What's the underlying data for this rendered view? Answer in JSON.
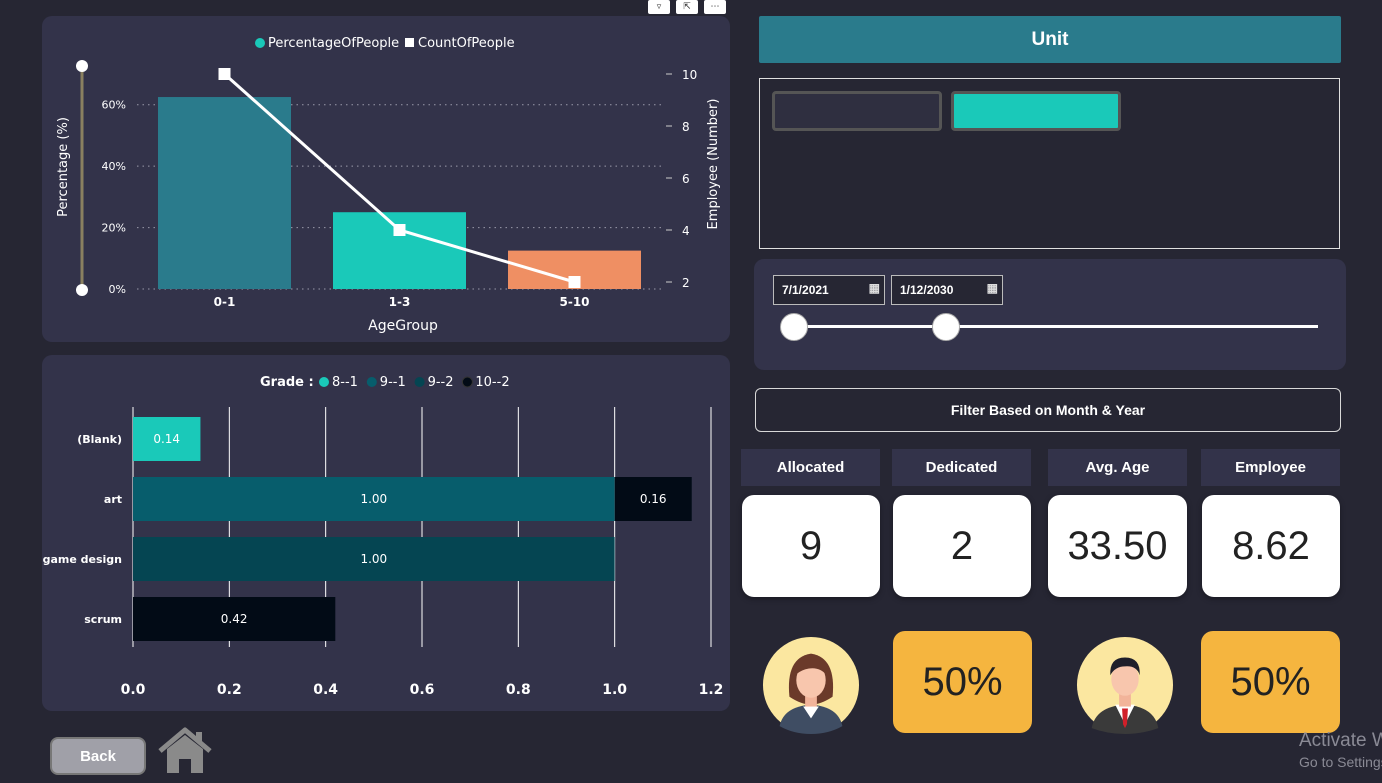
{
  "chart_data": [
    {
      "type": "bar",
      "legend": [
        "PercentageOfPeople",
        "CountOfPeople"
      ],
      "legend_position": "top",
      "xlabel": "AgeGroup",
      "ylabel": "Percentage (%)",
      "y2label": "Employee (Number)",
      "categories": [
        "0-1",
        "1-3",
        "5-10"
      ],
      "series": [
        {
          "name": "PercentageOfPeople",
          "kind": "bar",
          "values": [
            62.5,
            25,
            12.5
          ]
        },
        {
          "name": "CountOfPeople",
          "kind": "line",
          "values": [
            10,
            4,
            2
          ]
        }
      ],
      "ylim": [
        0,
        70
      ],
      "y2lim": [
        2,
        10
      ],
      "yticks": [
        "0%",
        "20%",
        "40%",
        "60%"
      ],
      "y2ticks": [
        "2",
        "4",
        "6",
        "8",
        "10"
      ],
      "bar_colors": [
        "#2a7b8c",
        "#1ac9b9",
        "#ef8f63"
      ],
      "grid": true
    },
    {
      "type": "bar",
      "orientation": "horizontal",
      "stacked": true,
      "legend_title": "Grade :",
      "legend_position": "top",
      "categories": [
        "(Blank)",
        "art",
        "game design",
        "scrum"
      ],
      "series": [
        {
          "name": "8--1",
          "color": "#1ac9b9",
          "values": [
            0.14,
            0,
            0,
            0
          ]
        },
        {
          "name": "9--1",
          "color": "#075d6c",
          "values": [
            0,
            1.0,
            0,
            0
          ]
        },
        {
          "name": "9--2",
          "color": "#054552",
          "values": [
            0,
            0,
            1.0,
            0
          ]
        },
        {
          "name": "10--2",
          "color": "#020b16",
          "values": [
            0,
            0.16,
            0,
            0.42
          ]
        }
      ],
      "xlim": [
        0,
        1.2
      ],
      "xticks": [
        "0.0",
        "0.2",
        "0.4",
        "0.6",
        "0.8",
        "1.0",
        "1.2"
      ],
      "grid": true
    }
  ],
  "unit": {
    "title": "Unit"
  },
  "dates": {
    "start": "7/1/2021",
    "end": "1/12/2030",
    "slider_start": 0,
    "slider_end": 0.29
  },
  "filter": {
    "label": "Filter Based on Month & Year"
  },
  "kpis": [
    {
      "label": "Allocated",
      "value": "9"
    },
    {
      "label": "Dedicated",
      "value": "2"
    },
    {
      "label": "Avg. Age",
      "value": "33.50"
    },
    {
      "label": "Employee",
      "value": "8.62"
    }
  ],
  "gender": {
    "female_pct": "50%",
    "male_pct": "50%"
  },
  "nav": {
    "back": "Back"
  },
  "watermark": {
    "line1": "Activate Windows",
    "line2": "Go to Settings to activate Windows."
  },
  "colors": {
    "background": "#262633",
    "panel": "#33334a",
    "accent": "#2a7b8c",
    "teal": "#1ac9b9",
    "orange": "#ef8f63",
    "gold": "#f5b53f"
  }
}
